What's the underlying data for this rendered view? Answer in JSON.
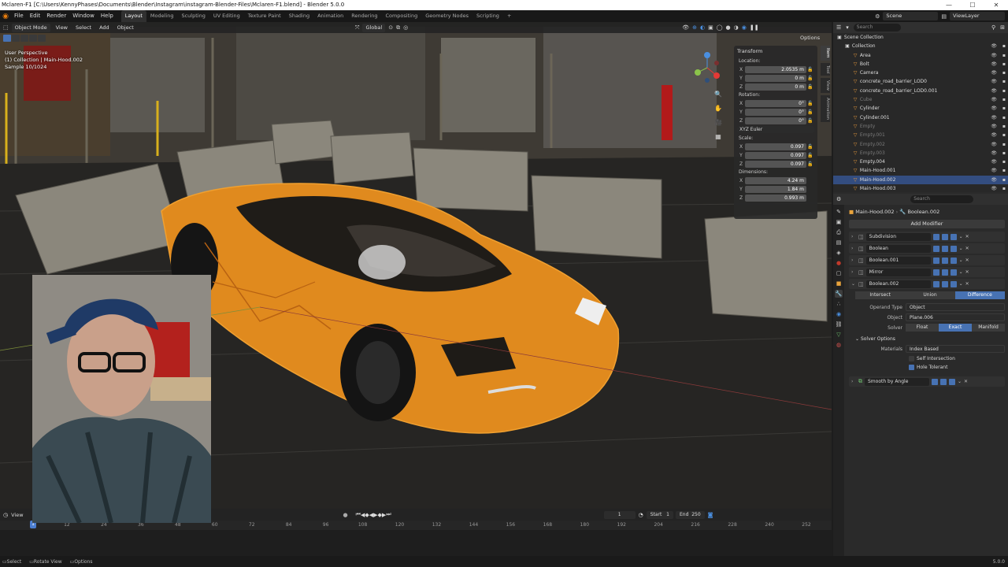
{
  "window": {
    "title": "Mclaren-F1 [C:\\Users\\KennyPhases\\Documents\\Blender\\Instagram\\instagram-Blender-Files\\Mclaren-F1.blend] - Blender 5.0.0",
    "minimize": "—",
    "maximize": "☐",
    "close": "✕"
  },
  "menu": [
    "File",
    "Edit",
    "Render",
    "Window",
    "Help"
  ],
  "workspaces": [
    "Layout",
    "Modeling",
    "Sculpting",
    "UV Editing",
    "Texture Paint",
    "Shading",
    "Animation",
    "Rendering",
    "Compositing",
    "Geometry Nodes",
    "Scripting",
    "+"
  ],
  "topbar": {
    "scene": "Scene",
    "view_layer": "ViewLayer"
  },
  "viewport": {
    "mode": "Object Mode",
    "menus": [
      "View",
      "Select",
      "Add",
      "Object"
    ],
    "orientation": "Global",
    "options": "Options",
    "info": [
      "User Perspective",
      "(1) Collection | Main-Hood.002",
      "Sample 10/1024"
    ]
  },
  "npanel": {
    "title": "Transform",
    "location_label": "Location:",
    "location": [
      [
        "X",
        "2.0535 m"
      ],
      [
        "Y",
        "0 m"
      ],
      [
        "Z",
        "0 m"
      ]
    ],
    "rotation_label": "Rotation:",
    "rotation": [
      [
        "X",
        "0°"
      ],
      [
        "Y",
        "0°"
      ],
      [
        "Z",
        "0°"
      ]
    ],
    "rotation_mode": "XYZ Euler",
    "scale_label": "Scale:",
    "scale": [
      [
        "X",
        "0.097"
      ],
      [
        "Y",
        "0.097"
      ],
      [
        "Z",
        "0.097"
      ]
    ],
    "dimensions_label": "Dimensions:",
    "dimensions": [
      [
        "X",
        "4.24 m"
      ],
      [
        "Y",
        "1.84 m"
      ],
      [
        "Z",
        "0.993 m"
      ]
    ],
    "tabs": [
      "Item",
      "Tool",
      "View",
      "Animation"
    ]
  },
  "outliner": {
    "search_placeholder": "Search",
    "rows": [
      {
        "label": "Scene Collection",
        "indent": 0,
        "dim": false,
        "sel": false
      },
      {
        "label": "Collection",
        "indent": 1,
        "dim": false,
        "sel": false
      },
      {
        "label": "Area",
        "indent": 2,
        "dim": false,
        "sel": false
      },
      {
        "label": "Bolt",
        "indent": 2,
        "dim": false,
        "sel": false
      },
      {
        "label": "Camera",
        "indent": 2,
        "dim": false,
        "sel": false
      },
      {
        "label": "concrete_road_barrier_LOD0",
        "indent": 2,
        "dim": false,
        "sel": false
      },
      {
        "label": "concrete_road_barrier_LOD0.001",
        "indent": 2,
        "dim": false,
        "sel": false
      },
      {
        "label": "Cube",
        "indent": 2,
        "dim": true,
        "sel": false
      },
      {
        "label": "Cylinder",
        "indent": 2,
        "dim": false,
        "sel": false
      },
      {
        "label": "Cylinder.001",
        "indent": 2,
        "dim": false,
        "sel": false
      },
      {
        "label": "Empty",
        "indent": 2,
        "dim": true,
        "sel": false
      },
      {
        "label": "Empty.001",
        "indent": 2,
        "dim": true,
        "sel": false
      },
      {
        "label": "Empty.002",
        "indent": 2,
        "dim": true,
        "sel": false
      },
      {
        "label": "Empty.003",
        "indent": 2,
        "dim": true,
        "sel": false
      },
      {
        "label": "Empty.004",
        "indent": 2,
        "dim": false,
        "sel": false
      },
      {
        "label": "Main-Hood.001",
        "indent": 2,
        "dim": false,
        "sel": false
      },
      {
        "label": "Main-Hood.002",
        "indent": 2,
        "dim": false,
        "sel": true
      },
      {
        "label": "Main-Hood.003",
        "indent": 2,
        "dim": false,
        "sel": false
      }
    ]
  },
  "properties": {
    "search_placeholder": "Search",
    "object": "Main-Hood.002",
    "modifier": "Boolean.002",
    "add_modifier": "Add Modifier",
    "modifiers": [
      "Subdivision",
      "Boolean",
      "Boolean.001",
      "Mirror",
      "Boolean.002"
    ],
    "operations": [
      "Intersect",
      "Union",
      "Difference"
    ],
    "operand_type_label": "Operand Type",
    "operand_type": "Object",
    "object_label": "Object",
    "object_value": "Plane.006",
    "solver_label": "Solver",
    "solvers": [
      "Float",
      "Exact",
      "Manifold"
    ],
    "solver_options": "Solver Options",
    "materials_label": "Materials",
    "materials": "Index Based",
    "self_intersection": "Self Intersection",
    "hole_tolerant": "Hole Tolerant",
    "last_modifier": "Smooth by Angle"
  },
  "timeline": {
    "current_frame": "1",
    "start_label": "Start",
    "start": "1",
    "end_label": "End",
    "end": "250",
    "view": "View",
    "ticks": [
      "1",
      "12",
      "24",
      "36",
      "48",
      "60",
      "72",
      "84",
      "96",
      "108",
      "120",
      "132",
      "144",
      "156",
      "168",
      "180",
      "192",
      "204",
      "216",
      "228",
      "240",
      "252"
    ]
  },
  "statusbar": [
    "Select",
    "Rotate View",
    "Options"
  ],
  "version": "5.0.0"
}
